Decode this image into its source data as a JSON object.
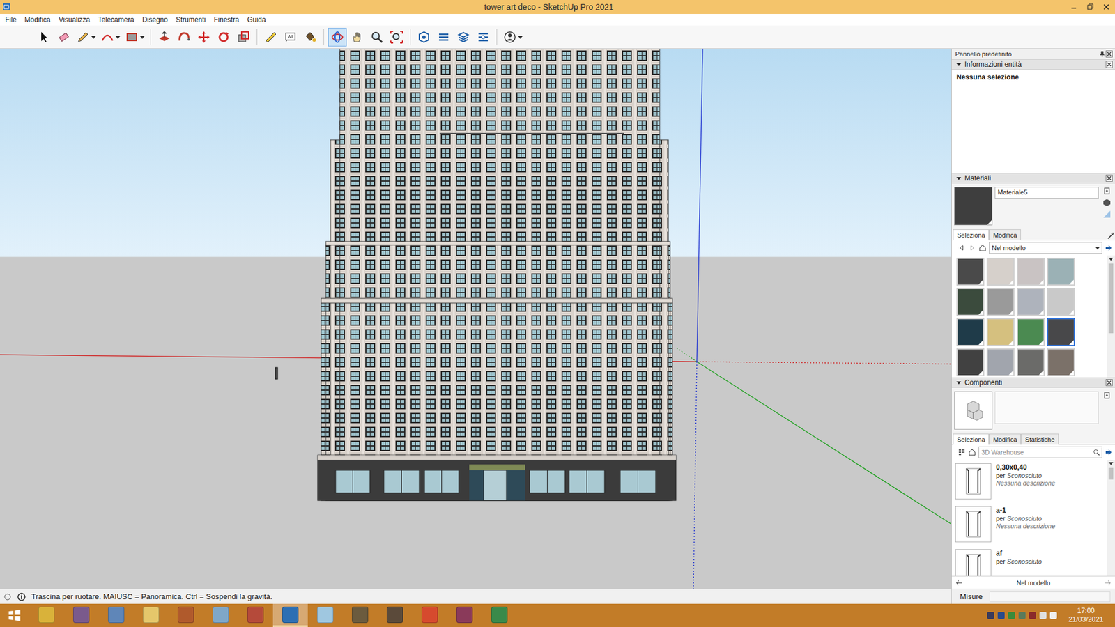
{
  "window": {
    "title": "tower art deco - SketchUp Pro 2021"
  },
  "menu": [
    "File",
    "Modifica",
    "Visualizza",
    "Telecamera",
    "Disegno",
    "Strumenti",
    "Finestra",
    "Guida"
  ],
  "toolbar": [
    {
      "selected": false
    },
    {
      "selected": false
    },
    {
      "selected": false
    },
    {
      "selected": false
    },
    {
      "selected": false
    },
    {
      "selected": false
    },
    {
      "selected": false
    },
    {
      "selected": false
    },
    {
      "selected": false
    },
    {
      "selected": false
    },
    {
      "selected": false
    },
    {
      "selected": false
    },
    {
      "selected": false
    },
    {
      "selected": true
    },
    {
      "selected": false
    },
    {
      "selected": false
    },
    {
      "selected": false
    },
    {
      "selected": false
    },
    {
      "selected": false
    },
    {
      "selected": false
    },
    {
      "selected": false
    },
    {
      "selected": false
    }
  ],
  "status_bar": {
    "text": "Trascina per ruotare. MAIUSC = Panoramica. Ctrl = Sospendi la gravità.",
    "measure_label": "Misure"
  },
  "panel": {
    "title": "Pannello predefinito",
    "entity_info": {
      "title": "Informazioni entità",
      "expanded": true,
      "text": "Nessuna selezione"
    },
    "materials": {
      "title": "Materiali",
      "expanded": true,
      "current": {
        "name": "Materiale5",
        "color": "#3e3e3e"
      },
      "tabs": [
        {
          "label": "Seleziona",
          "selected": true
        },
        {
          "label": "Modifica",
          "selected": false
        }
      ],
      "collection": "Nel modello",
      "swatches": [
        {
          "color": "#4a4a4a",
          "selected": false
        },
        {
          "color": "#d6d0cb",
          "selected": false
        },
        {
          "color": "#c9c3c3",
          "selected": false
        },
        {
          "color": "#9bb1b5",
          "selected": false
        },
        {
          "color": "#3b4b3d",
          "selected": false
        },
        {
          "color": "#9a9a9a",
          "selected": false
        },
        {
          "color": "#aeb3bc",
          "selected": false
        },
        {
          "color": "#c9c9c9",
          "selected": false
        },
        {
          "color": "#1f3b49",
          "selected": false
        },
        {
          "color": "#d5c07f",
          "selected": false
        },
        {
          "color": "#4b8a51",
          "selected": false
        },
        {
          "color": "#48484a",
          "selected": true
        },
        {
          "color": "#414141",
          "selected": false
        },
        {
          "color": "#a1a5ad",
          "selected": false
        },
        {
          "color": "#6b6b69",
          "selected": false
        },
        {
          "color": "#7b7169",
          "selected": false
        }
      ]
    },
    "components": {
      "title": "Componenti",
      "expanded": true,
      "tabs": [
        {
          "label": "Seleziona",
          "selected": true
        },
        {
          "label": "Modifica",
          "selected": false
        },
        {
          "label": "Statistiche",
          "selected": false
        }
      ],
      "search": {
        "placeholder": "3D Warehouse"
      },
      "items": [
        {
          "name": "0,30x0,40",
          "by": "per",
          "author": "Sconosciuto",
          "description": "Nessuna descrizione"
        },
        {
          "name": "a-1",
          "by": "per",
          "author": "Sconosciuto",
          "description": "Nessuna descrizione"
        },
        {
          "name": "af",
          "by": "per",
          "author": "Sconosciuto"
        }
      ],
      "collection": "Nel modello"
    }
  },
  "taskbar": {
    "apps": [
      {
        "selected": false
      },
      {
        "selected": false
      },
      {
        "selected": false
      },
      {
        "selected": false
      },
      {
        "selected": false
      },
      {
        "selected": false
      },
      {
        "selected": false
      },
      {
        "selected": true
      },
      {
        "selected": false
      },
      {
        "selected": false
      },
      {
        "selected": false
      },
      {
        "selected": false
      },
      {
        "selected": false
      },
      {
        "selected": false
      }
    ],
    "time": "17:00",
    "date": "21/03/2021"
  }
}
